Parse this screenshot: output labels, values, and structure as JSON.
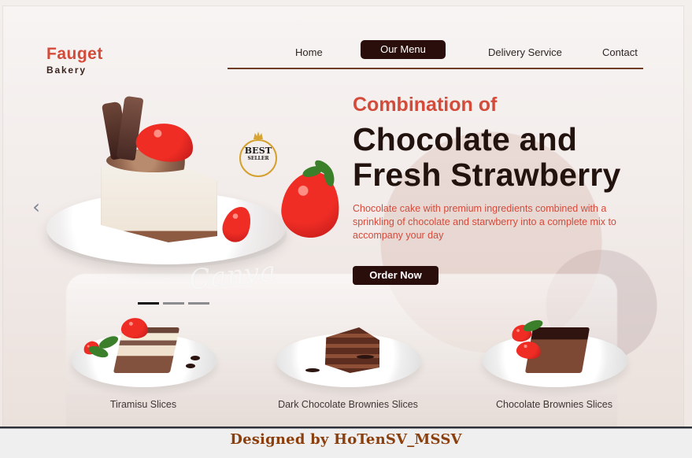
{
  "brand": {
    "name": "Fauget",
    "subtitle": "Bakery"
  },
  "nav": {
    "items": [
      {
        "label": "Home"
      },
      {
        "label": "Our Menu"
      },
      {
        "label": "Delivery Service"
      },
      {
        "label": "Contact"
      }
    ]
  },
  "hero": {
    "eyebrow": "Combination of",
    "headline_line1": "Chocolate and",
    "headline_line2": "Fresh Strawberry",
    "description": "Chocolate cake with premium ingredients combined with a sprinkling of chocolate and starwberry into a complete mix to accompany your day",
    "cta_label": "Order Now",
    "badge_text_1": "BEST",
    "badge_text_2": "SELLER",
    "watermark": "Canva"
  },
  "carousel": {
    "prev_icon": "chevron-left-icon",
    "next_icon": "chevron-right-icon",
    "dots": [
      {
        "state": "active"
      },
      {
        "state": "inactive"
      },
      {
        "state": "inactive"
      }
    ]
  },
  "products": [
    {
      "name": "Tiramisu Slices"
    },
    {
      "name": "Dark Chocolate Brownies Slices"
    },
    {
      "name": "Chocolate Brownies Slices"
    }
  ],
  "footer_caption": "Designed by HoTenSV_MSSV",
  "colors": {
    "accent_red": "#d34b3b",
    "dark_brown": "#2a0e0b",
    "footer_brown": "#8b3f0d"
  }
}
